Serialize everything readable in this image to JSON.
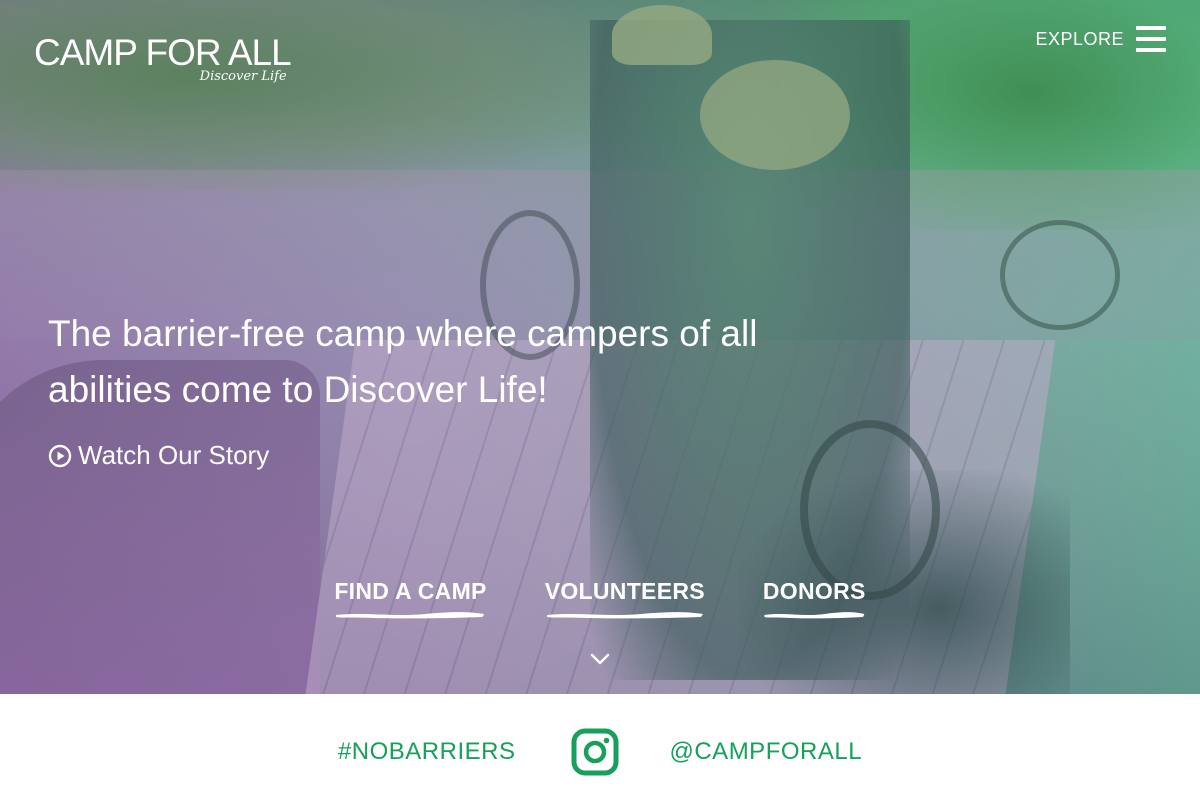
{
  "brand": {
    "name": "CAMP FOR ALL",
    "tagline": "Discover Life",
    "accent_color": "#17a05a"
  },
  "nav": {
    "explore_label": "EXPLORE",
    "menu_icon": "hamburger-menu-icon"
  },
  "hero": {
    "headline": "The barrier-free camp where campers of all abilities come to Discover Life!",
    "watch_label": "Watch Our Story",
    "watch_icon": "play-circle-icon",
    "cta": [
      {
        "label": "FIND A CAMP"
      },
      {
        "label": "VOLUNTEERS"
      },
      {
        "label": "DONORS"
      }
    ],
    "scroll_icon": "chevron-down-icon"
  },
  "social": {
    "hashtag": "#NOBARRIERS",
    "icon": "instagram-icon",
    "handle": "@CAMPFORALL"
  }
}
